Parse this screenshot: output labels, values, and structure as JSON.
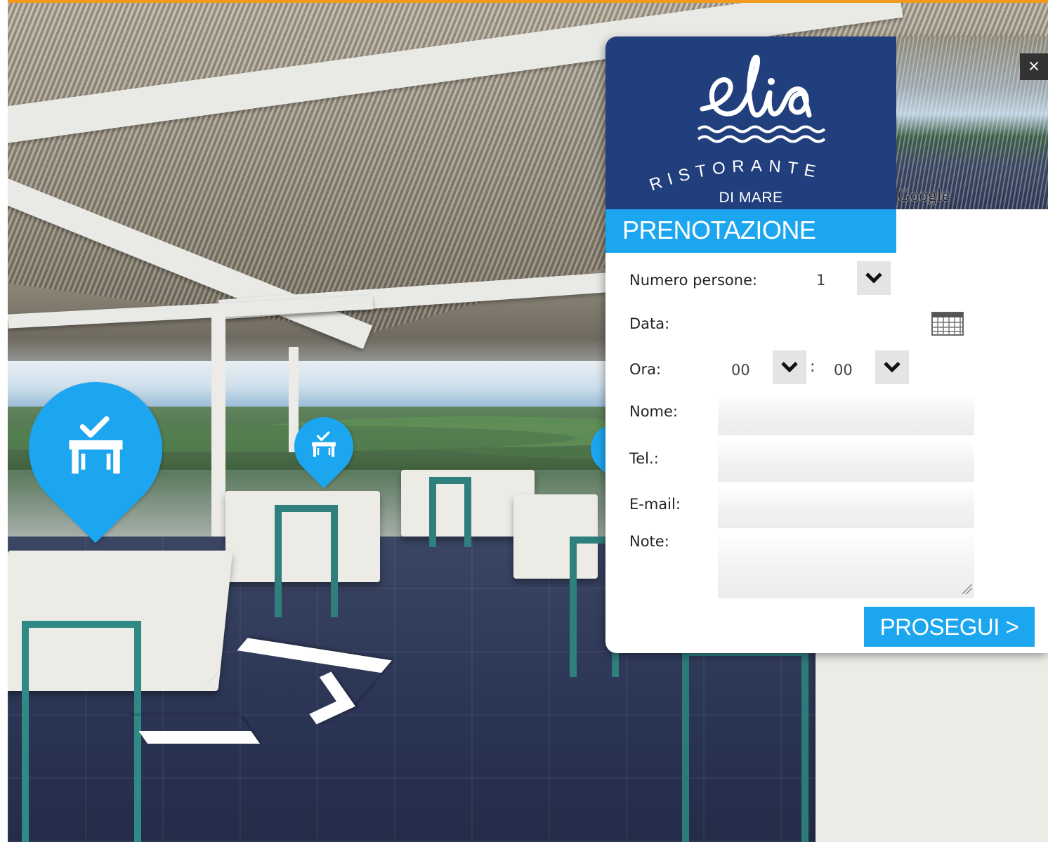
{
  "brand": {
    "name": "elia",
    "subtitle": "RISTORANTE",
    "location": "DI MARE",
    "color": "#213f7d"
  },
  "accent_color": "#1ca6f0",
  "photo_attribution": "Google",
  "close_icon": "×",
  "form": {
    "title": "PRENOTAZIONE",
    "persons_label": "Numero persone:",
    "persons_value": "1",
    "date_label": "Data:",
    "date_value": "",
    "time_label": "Ora:",
    "hour_value": "00",
    "time_separator": ":",
    "minute_value": "00",
    "name_label": "Nome:",
    "name_value": "",
    "phone_label": "Tel.:",
    "phone_value": "",
    "email_label": "E-mail:",
    "email_value": "",
    "note_label": "Note:",
    "note_value": "",
    "submit_label": "PROSEGUI >"
  },
  "markers": [
    {
      "icon": "table-check-icon"
    },
    {
      "icon": "table-check-icon"
    },
    {
      "icon": "table-check-icon"
    }
  ],
  "navigation": {
    "icon": "chevron-arrow-icon"
  }
}
